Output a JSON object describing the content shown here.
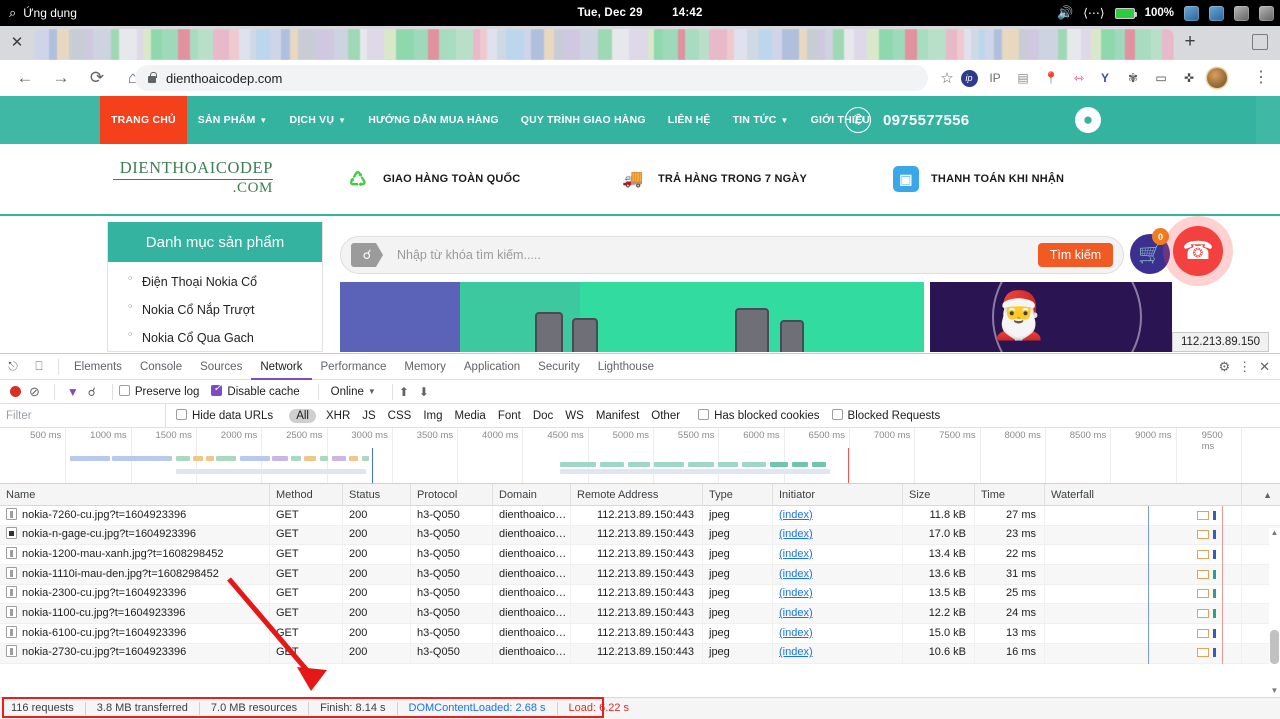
{
  "os_bar": {
    "apps_label": "Ứng dụng",
    "search_icon": "search-icon",
    "date": "Tue, Dec 29",
    "time": "14:42",
    "volume_icon": "volume-icon",
    "network_icon": "network-icon",
    "battery_icon": "battery-icon",
    "battery_percent": "100%"
  },
  "browser": {
    "close_tab_icon": "close-icon",
    "new_tab_icon": "plus-icon",
    "restore_icon": "restore-window-icon",
    "back_icon": "back-arrow-icon",
    "forward_icon": "forward-arrow-icon",
    "reload_icon": "reload-icon",
    "home_icon": "home-icon",
    "lock_icon": "lock-icon",
    "url": "dienthoaicodep.com",
    "bookmark_icon": "star-icon",
    "menu_icon": "kebab-menu-icon",
    "extensions": [
      {
        "name": "ip-extension-icon",
        "glyph": "ip"
      },
      {
        "name": "ip-search-extension-icon",
        "glyph": "IP"
      },
      {
        "name": "clipboard-extension-icon",
        "glyph": "▣"
      },
      {
        "name": "location-pin-extension-icon",
        "glyph": "◕"
      },
      {
        "name": "ruler-extension-icon",
        "glyph": "⇿"
      },
      {
        "name": "yandex-extension-icon",
        "glyph": "Y"
      },
      {
        "name": "gear-extension-icon",
        "glyph": "✾"
      },
      {
        "name": "camera-extension-icon",
        "glyph": "▭"
      },
      {
        "name": "puzzle-extension-icon",
        "glyph": "✜"
      },
      {
        "name": "profile-avatar-icon",
        "glyph": "●"
      }
    ]
  },
  "site": {
    "nav": [
      {
        "label": "TRANG CHỦ",
        "active": true,
        "caret": false
      },
      {
        "label": "SẢN PHẨM",
        "active": false,
        "caret": true
      },
      {
        "label": "DỊCH VỤ",
        "active": false,
        "caret": true
      },
      {
        "label": "HƯỚNG DẪN MUA HÀNG",
        "active": false,
        "caret": false
      },
      {
        "label": "QUY TRÌNH GIAO HÀNG",
        "active": false,
        "caret": false
      },
      {
        "label": "LIÊN HỆ",
        "active": false,
        "caret": false
      },
      {
        "label": "TIN TỨC",
        "active": false,
        "caret": true
      },
      {
        "label": "GIỚI THIỆU",
        "active": false,
        "caret": false
      }
    ],
    "phone_icon": "phone-icon",
    "phone": "0975577556",
    "account_icon": "user-account-icon",
    "logo_line1": "DIENTHOAICODEP",
    "logo_line2": ".COM",
    "features": [
      {
        "icon": "refresh-green-icon",
        "glyph": "♻",
        "label": "GIAO HÀNG TOÀN QUỐC"
      },
      {
        "icon": "truck-icon",
        "glyph": "🚚",
        "label": "TRẢ HÀNG TRONG 7 NGÀY"
      },
      {
        "icon": "cash-on-delivery-icon",
        "glyph": "▣",
        "label": "THANH TOÁN KHI NHẬN"
      }
    ],
    "sidebar_title": "Danh mục sản phẩm",
    "sidebar_items": [
      "Điện Thoại Nokia Cổ",
      "Nokia Cổ Nắp Trượt",
      "Nokia Cổ Qua Gach"
    ],
    "search_icon": "search-icon",
    "search_placeholder": "Nhập từ khóa tìm kiếm.....",
    "search_button": "Tìm kiếm",
    "cart_icon": "cart-icon",
    "cart_count": "0",
    "call_fab_icon": "phone-call-icon",
    "ip_tooltip": "112.213.89.150"
  },
  "devtools": {
    "inspect_icon": "inspect-element-icon",
    "device_icon": "device-toolbar-icon",
    "tabs": [
      {
        "label": "Elements",
        "selected": false
      },
      {
        "label": "Console",
        "selected": false
      },
      {
        "label": "Sources",
        "selected": false
      },
      {
        "label": "Network",
        "selected": true
      },
      {
        "label": "Performance",
        "selected": false
      },
      {
        "label": "Memory",
        "selected": false
      },
      {
        "label": "Application",
        "selected": false
      },
      {
        "label": "Security",
        "selected": false
      },
      {
        "label": "Lighthouse",
        "selected": false
      }
    ],
    "settings_icon": "gear-icon",
    "more_icon": "kebab-menu-icon",
    "close_icon": "close-icon",
    "toolbar": {
      "record_icon": "record-icon",
      "clear_icon": "clear-icon",
      "filter_icon": "filter-icon",
      "search_icon": "search-icon",
      "preserve_log_label": "Preserve log",
      "preserve_log_checked": false,
      "disable_cache_label": "Disable cache",
      "disable_cache_checked": true,
      "throttling": "Online",
      "import_icon": "import-har-icon",
      "export_icon": "export-har-icon"
    },
    "filter": {
      "placeholder": "Filter",
      "hide_data_urls_label": "Hide data URLs",
      "hide_data_urls_checked": false,
      "types": [
        "All",
        "XHR",
        "JS",
        "CSS",
        "Img",
        "Media",
        "Font",
        "Doc",
        "WS",
        "Manifest",
        "Other"
      ],
      "selected_type": "All",
      "has_blocked_cookies_label": "Has blocked cookies",
      "has_blocked_cookies_checked": false,
      "blocked_requests_label": "Blocked Requests",
      "blocked_requests_checked": false
    },
    "timeline_ticks": [
      "500 ms",
      "1000 ms",
      "1500 ms",
      "2000 ms",
      "2500 ms",
      "3000 ms",
      "3500 ms",
      "4000 ms",
      "4500 ms",
      "5000 ms",
      "5500 ms",
      "6000 ms",
      "6500 ms",
      "7000 ms",
      "7500 ms",
      "8000 ms",
      "8500 ms",
      "9000 ms",
      "9500 ms"
    ],
    "columns": [
      "Name",
      "Method",
      "Status",
      "Protocol",
      "Domain",
      "Remote Address",
      "Type",
      "Initiator",
      "Size",
      "Time",
      "Waterfall"
    ],
    "sort_icon": "sort-ascending-icon",
    "rows": [
      {
        "name": "nokia-7260-cu.jpg?t=1604923396",
        "method": "GET",
        "status": "200",
        "protocol": "h3-Q050",
        "domain": "dienthoaico…",
        "remote": "112.213.89.150:443",
        "type": "jpeg",
        "initiator": "(index)",
        "size": "11.8 kB",
        "time": "27 ms"
      },
      {
        "name": "nokia-n-gage-cu.jpg?t=1604923396",
        "method": "GET",
        "status": "200",
        "protocol": "h3-Q050",
        "domain": "dienthoaico…",
        "remote": "112.213.89.150:443",
        "type": "jpeg",
        "initiator": "(index)",
        "size": "17.0 kB",
        "time": "23 ms"
      },
      {
        "name": "nokia-1200-mau-xanh.jpg?t=1608298452",
        "method": "GET",
        "status": "200",
        "protocol": "h3-Q050",
        "domain": "dienthoaico…",
        "remote": "112.213.89.150:443",
        "type": "jpeg",
        "initiator": "(index)",
        "size": "13.4 kB",
        "time": "22 ms"
      },
      {
        "name": "nokia-1110i-mau-den.jpg?t=1608298452",
        "method": "GET",
        "status": "200",
        "protocol": "h3-Q050",
        "domain": "dienthoaico…",
        "remote": "112.213.89.150:443",
        "type": "jpeg",
        "initiator": "(index)",
        "size": "13.6 kB",
        "time": "31 ms"
      },
      {
        "name": "nokia-2300-cu.jpg?t=1604923396",
        "method": "GET",
        "status": "200",
        "protocol": "h3-Q050",
        "domain": "dienthoaico…",
        "remote": "112.213.89.150:443",
        "type": "jpeg",
        "initiator": "(index)",
        "size": "13.5 kB",
        "time": "25 ms"
      },
      {
        "name": "nokia-1100-cu.jpg?t=1604923396",
        "method": "GET",
        "status": "200",
        "protocol": "h3-Q050",
        "domain": "dienthoaico…",
        "remote": "112.213.89.150:443",
        "type": "jpeg",
        "initiator": "(index)",
        "size": "12.2 kB",
        "time": "24 ms"
      },
      {
        "name": "nokia-6100-cu.jpg?t=1604923396",
        "method": "GET",
        "status": "200",
        "protocol": "h3-Q050",
        "domain": "dienthoaico…",
        "remote": "112.213.89.150:443",
        "type": "jpeg",
        "initiator": "(index)",
        "size": "15.0 kB",
        "time": "13 ms"
      },
      {
        "name": "nokia-2730-cu.jpg?t=1604923396",
        "method": "GET",
        "status": "200",
        "protocol": "h3-Q050",
        "domain": "dienthoaico…",
        "remote": "112.213.89.150:443",
        "type": "jpeg",
        "initiator": "(index)",
        "size": "10.6 kB",
        "time": "16 ms"
      }
    ],
    "status_bar": {
      "requests": "116 requests",
      "transferred": "3.8 MB transferred",
      "resources": "7.0 MB resources",
      "finish": "Finish: 8.14 s",
      "dom_content_loaded": "DOMContentLoaded: 2.68 s",
      "load": "Load: 6.22 s"
    },
    "annotation": {
      "arrow_icon": "red-arrow-icon",
      "highlight_icon": "red-highlight-box"
    }
  }
}
